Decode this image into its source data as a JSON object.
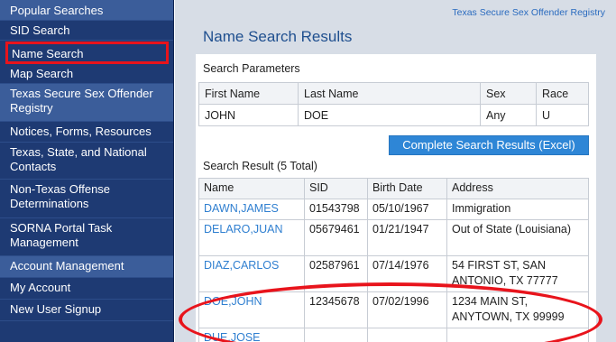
{
  "sidebar": {
    "items": [
      {
        "label": "Popular Searches"
      },
      {
        "label": "SID Search"
      },
      {
        "label": "Name Search"
      },
      {
        "label": "Map Search"
      },
      {
        "label": "Texas Secure Sex Offender Registry"
      },
      {
        "label": "Notices, Forms, Resources"
      },
      {
        "label": "Texas, State, and National Contacts"
      },
      {
        "label": "Non-Texas Offense Determinations"
      },
      {
        "label": "SORNA Portal Task Management"
      },
      {
        "label": "Account Management"
      },
      {
        "label": "My Account"
      },
      {
        "label": "New User Signup"
      }
    ]
  },
  "header": {
    "top_link": "Texas Secure Sex Offender Registry",
    "title": "Name Search Results"
  },
  "params": {
    "label": "Search Parameters",
    "columns": [
      "First Name",
      "Last Name",
      "Sex",
      "Race"
    ],
    "row": [
      "JOHN",
      "DOE",
      "Any",
      "U"
    ]
  },
  "excel_button": "Complete Search Results (Excel)",
  "results": {
    "label": "Search Result (5 Total)",
    "columns": [
      "Name",
      "SID",
      "Birth Date",
      "Address"
    ],
    "rows": [
      {
        "name": "DAWN,JAMES",
        "sid": "01543798",
        "birth": "05/10/1967",
        "address": "Immigration"
      },
      {
        "name": "DELARO,JUAN",
        "sid": "05679461",
        "birth": "01/21/1947",
        "address": "Out of State (Louisiana)"
      },
      {
        "name": "DIAZ,CARLOS",
        "sid": "02587961",
        "birth": "07/14/1976",
        "address": "54 FIRST ST, SAN ANTONIO, TX 77777"
      },
      {
        "name": "DOE,JOHN",
        "sid": "12345678",
        "birth": "07/02/1996",
        "address": "1234 MAIN ST, ANYTOWN, TX 99999"
      },
      {
        "name": "DUE,JOSE",
        "sid": "",
        "birth": "",
        "address": ""
      }
    ]
  },
  "colors": {
    "sidebar_bg": "#1e3a73",
    "sidebar_header_bg": "#3b5d9a",
    "highlight": "#e8141c",
    "link": "#2f7fd0",
    "button_bg": "#2e86d6"
  }
}
